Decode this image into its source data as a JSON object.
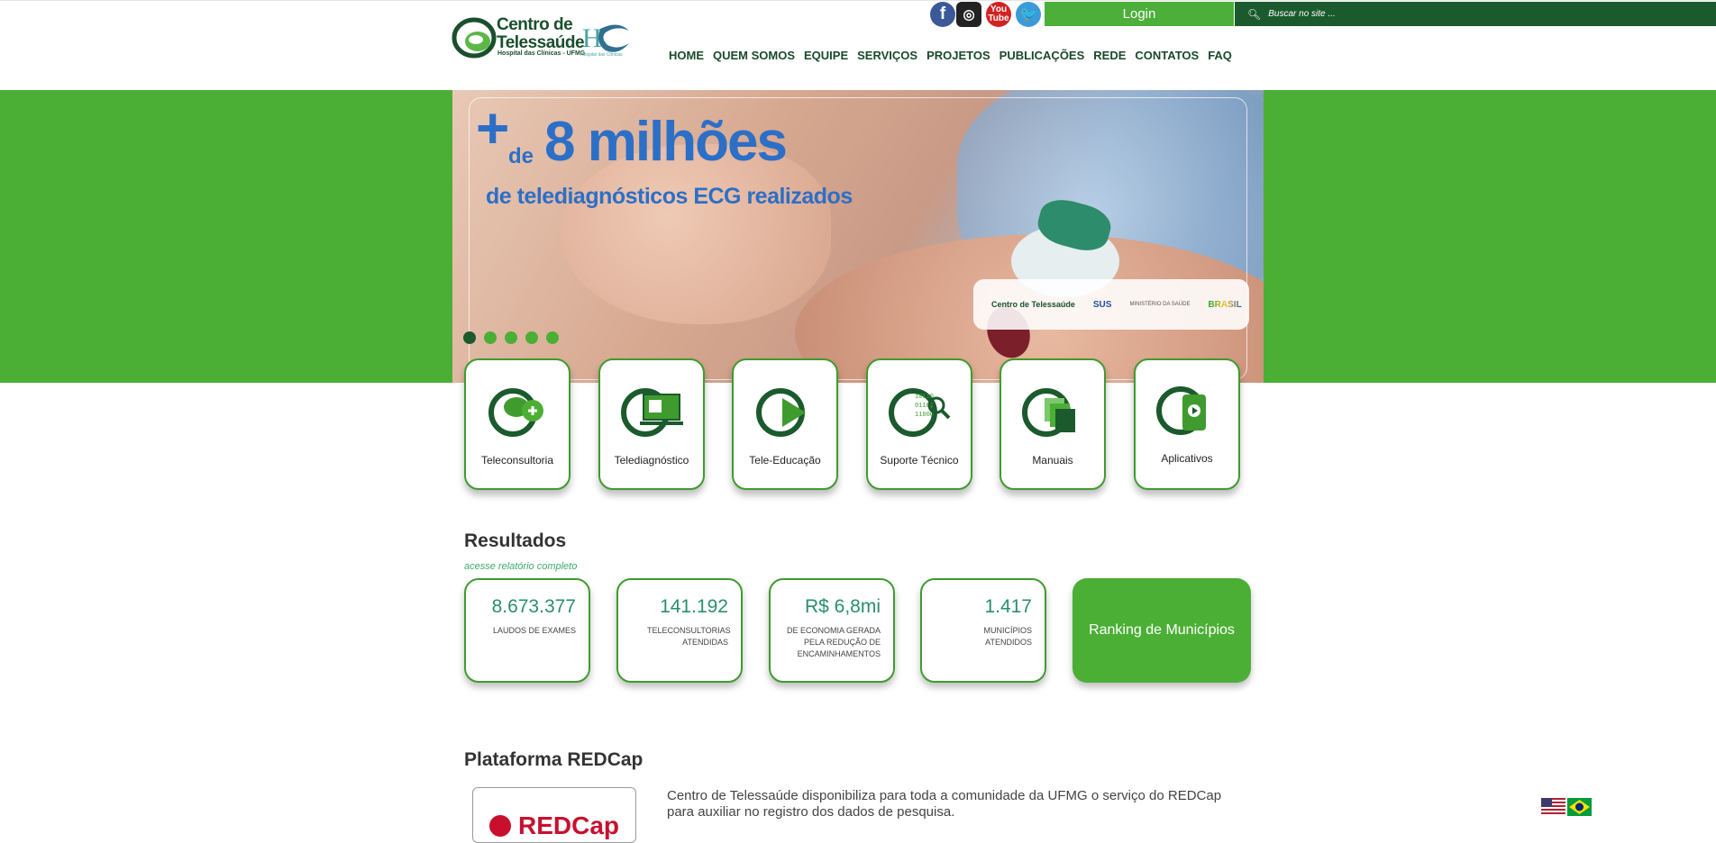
{
  "header": {
    "logo_line1": "Centro de",
    "logo_line2": "Telessaúde",
    "logo_sub": "Hospital das Clínicas - UFMG",
    "hc_sub": "Hospital das Clínicas",
    "social": [
      "facebook-icon",
      "instagram-icon",
      "youtube-icon",
      "twitter-icon"
    ],
    "login_label": "Login",
    "search_placeholder": "Buscar no site ...",
    "nav": [
      "HOME",
      "QUEM SOMOS",
      "EQUIPE",
      "SERVIÇOS",
      "PROJETOS",
      "PUBLICAÇÕES",
      "REDE",
      "CONTATOS",
      "FAQ"
    ]
  },
  "banner": {
    "plus": "+",
    "de": "de",
    "headline": "8 milhões",
    "subline": "de telediagnósticos ECG realizados",
    "partners": [
      "Centro de Telessaúde",
      "SUS",
      "MINISTÉRIO DA SAÚDE",
      "BRASIL"
    ],
    "slides_count": 5,
    "active_slide": 1
  },
  "services": [
    "Teleconsultoria",
    "Telediagnóstico",
    "Tele-Educação",
    "Suporte Técnico",
    "Manuais",
    "Aplicativos"
  ],
  "resultados": {
    "title": "Resultados",
    "link": "acesse relatório completo",
    "stats": [
      {
        "value": "8.673.377",
        "desc": "LAUDOS DE EXAMES"
      },
      {
        "value": "141.192",
        "desc": "TELECONSULTORIAS ATENDIDAS"
      },
      {
        "value": "R$ 6,8mi",
        "desc": "DE ECONOMIA GERADA PELA REDUÇÃO DE ENCAMINHAMENTOS"
      },
      {
        "value": "1.417",
        "desc": "MUNICÍPIOS ATENDIDOS"
      }
    ],
    "ranking_label": "Ranking de Municípios"
  },
  "redcap": {
    "title": "Plataforma REDCap",
    "logo_text": "REDCap",
    "text": "Centro de Telessaúde disponibiliza para toda a comunidade da UFMG o serviço do REDCap para auxiliar no registro dos dados de pesquisa."
  },
  "colors": {
    "green": "#4caf35",
    "dark_green": "#1b5a2c",
    "blue": "#2c6fc7"
  }
}
